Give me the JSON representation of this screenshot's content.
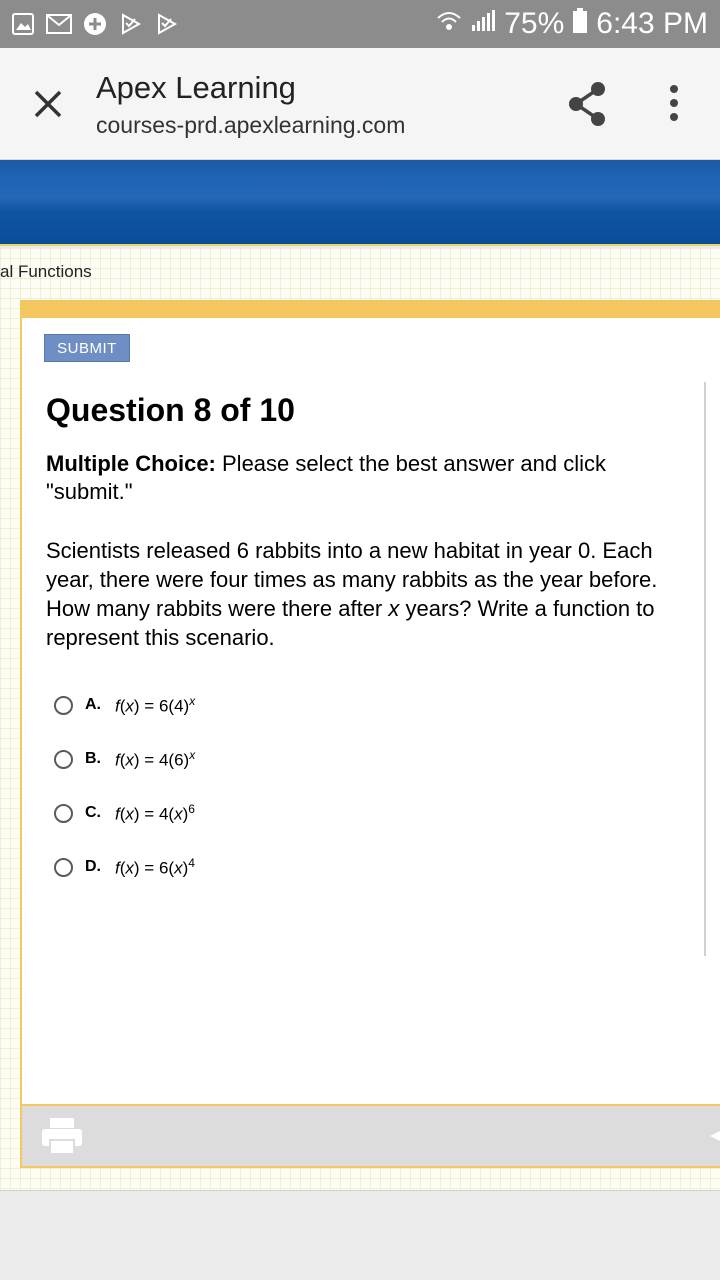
{
  "status_bar": {
    "battery": "75%",
    "time": "6:43 PM"
  },
  "tab": {
    "title": "Apex Learning",
    "url": "courses-prd.apexlearning.com"
  },
  "breadcrumb": "al Functions",
  "submit_label": "SUBMIT",
  "question": {
    "title": "Question 8 of 10",
    "instruction_bold": "Multiple Choice:",
    "instruction_rest": " Please select the best answer and click \"submit.\"",
    "text_before": "Scientists released 6 rabbits into a new habitat in year 0. Each year, there were four times as many rabbits as the year before. How many rabbits were there after ",
    "text_var": "x",
    "text_after": " years? Write a function to represent this scenario."
  },
  "choices": [
    {
      "letter": "A.",
      "fn": "f",
      "arg": "x",
      "rhs": " = 6(4)",
      "exp": "x",
      "exp_italic": true
    },
    {
      "letter": "B.",
      "fn": "f",
      "arg": "x",
      "rhs": " = 4(6)",
      "exp": "x",
      "exp_italic": true
    },
    {
      "letter": "C.",
      "fn": "f",
      "arg": "x",
      "rhs_pre": " = 4(",
      "rhs_var": "x",
      "rhs_post": ")",
      "exp": "6",
      "exp_italic": false
    },
    {
      "letter": "D.",
      "fn": "f",
      "arg": "x",
      "rhs_pre": " = 6(",
      "rhs_var": "x",
      "rhs_post": ")",
      "exp": "4",
      "exp_italic": false
    }
  ],
  "colors": {
    "status_bar": "#8c8c8c",
    "banner": "#1e63b5",
    "accent_yellow": "#f4c660",
    "submit_button": "#6f8fc4"
  }
}
